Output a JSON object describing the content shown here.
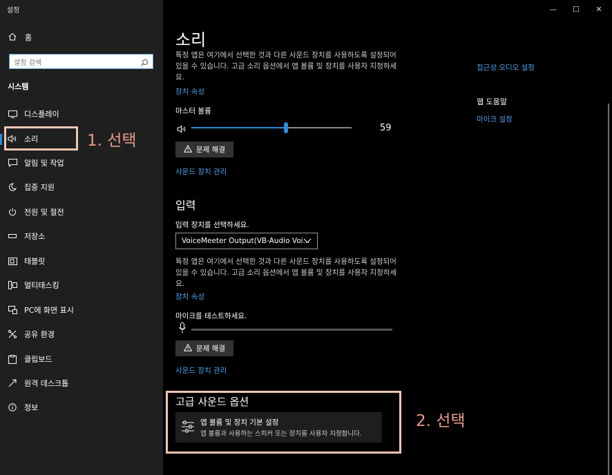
{
  "window": {
    "title": "설정",
    "controls": {
      "minimize": "—",
      "maximize": "☐",
      "close": "✕"
    }
  },
  "sidebar": {
    "home_label": "홈",
    "search_placeholder": "설정 검색",
    "section_label": "시스템",
    "items": [
      {
        "label": "디스플레이",
        "icon": "display-icon"
      },
      {
        "label": "소리",
        "icon": "speaker-icon",
        "selected": true
      },
      {
        "label": "알림 및 작업",
        "icon": "notification-icon"
      },
      {
        "label": "집중 지원",
        "icon": "moon-icon"
      },
      {
        "label": "전원 및 절전",
        "icon": "power-icon"
      },
      {
        "label": "저장소",
        "icon": "storage-icon"
      },
      {
        "label": "태블릿",
        "icon": "tablet-icon"
      },
      {
        "label": "멀티태스킹",
        "icon": "multitasking-icon"
      },
      {
        "label": "PC에 화면 표시",
        "icon": "project-icon"
      },
      {
        "label": "공유 환경",
        "icon": "share-icon"
      },
      {
        "label": "클립보드",
        "icon": "clipboard-icon"
      },
      {
        "label": "원격 데스크톱",
        "icon": "remote-desktop-icon"
      },
      {
        "label": "정보",
        "icon": "info-icon"
      }
    ]
  },
  "annotations": {
    "step1": "1. 선택",
    "step2": "2. 선택",
    "highlight_color": "#f3c6b4",
    "text_color": "#e99a8c"
  },
  "main": {
    "title": "소리",
    "output": {
      "description": "특정 앱은 여기에서 선택한 것과 다른 사운드 장치를 사용하도록 설정되어 있을 수 있습니다. 고급 소리 옵션에서 앱 볼륨 및 장치를 사용자 지정하세요.",
      "device_properties_link": "장치 속성",
      "master_volume_label": "마스터 볼륨",
      "volume_value": "59",
      "volume_percent": 59,
      "troubleshoot_label": "문제 해결",
      "manage_devices_link": "사운드 장치 관리"
    },
    "input": {
      "heading": "입력",
      "select_label": "입력 장치를 선택하세요.",
      "selected_device": "VoiceMeeter Output(VB-Audio Voi...",
      "description": "특정 앱은 여기에서 선택한 것과 다른 사운드 장치를 사용하도록 설정되어 있을 수 있습니다. 고급 소리 옵션에서 앱 볼륨 및 장치를 사용자 지정하세요.",
      "device_properties_link": "장치 속성",
      "mic_test_label": "마이크를 테스트하세요.",
      "troubleshoot_label": "문제 해결",
      "manage_devices_link": "사운드 장치 관리"
    },
    "advanced": {
      "heading": "고급 사운드 옵션",
      "card_title": "앱 볼륨 및 장치 기본 설정",
      "card_subtitle": "앱 볼륨과 사용하는 스피커 또는 장치를 사용자 지정합니다."
    }
  },
  "right_panel": {
    "ease_of_access_link": "접근성 오디오 설정",
    "help_heading": "웹 도움말",
    "mic_setup_link": "마이크 설정"
  },
  "colors": {
    "sidebar_bg": "#1f1f1f",
    "main_bg": "#000000",
    "accent": "#2a8cdc",
    "link": "#4aa2e8"
  }
}
